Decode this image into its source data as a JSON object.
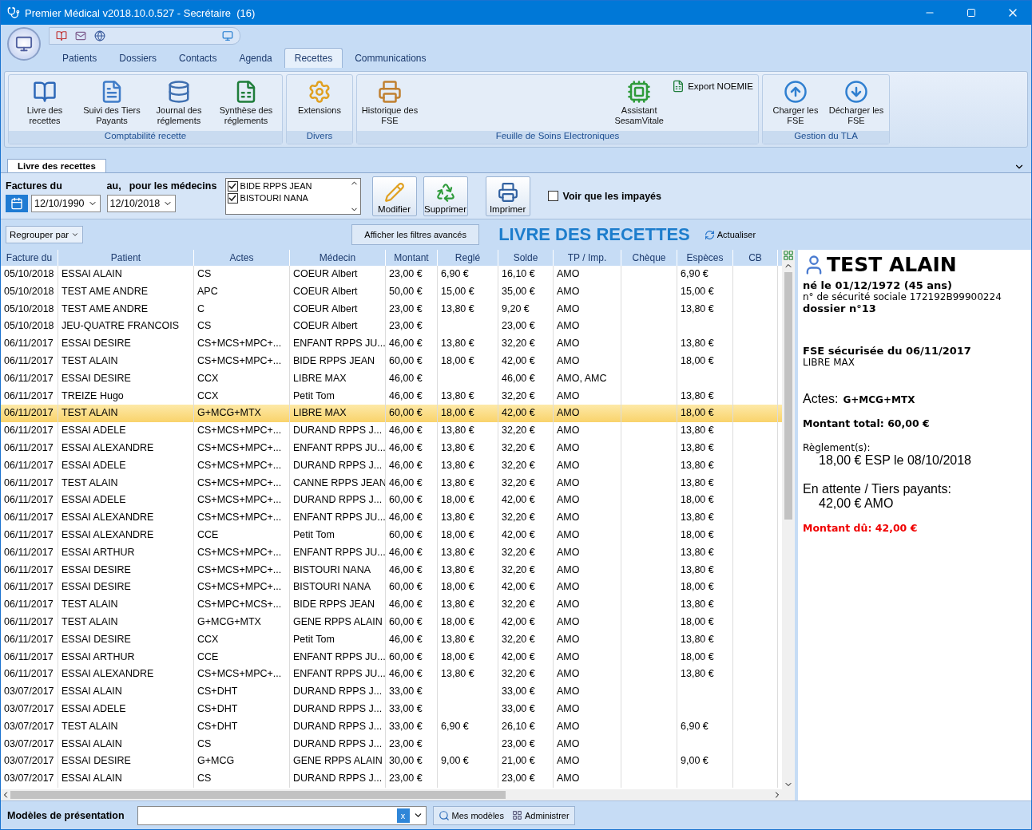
{
  "window": {
    "title": "Premier Médical v2018.10.0.527 - Secrétaire  (16)"
  },
  "menu_tabs": [
    {
      "label": "Patients",
      "selected": false
    },
    {
      "label": "Dossiers",
      "selected": false
    },
    {
      "label": "Contacts",
      "selected": false
    },
    {
      "label": "Agenda",
      "selected": false
    },
    {
      "label": "Recettes",
      "selected": true
    },
    {
      "label": "Communications",
      "selected": false
    }
  ],
  "ribbon_groups": [
    {
      "title": "Comptabilité recette",
      "buttons": [
        {
          "label": "Livre des recettes"
        },
        {
          "label": "Suivi des Tiers Payants"
        },
        {
          "label": "Journal des réglements"
        },
        {
          "label": "Synthèse des réglements"
        }
      ]
    },
    {
      "title": "Divers",
      "buttons": [
        {
          "label": "Extensions"
        }
      ]
    },
    {
      "title": "Feuille de Soins Electroniques",
      "buttons": [
        {
          "label": "Historique des FSE"
        },
        {
          "label": "Assistant SesamVitale"
        },
        {
          "label": "Export NOEMIE"
        }
      ]
    },
    {
      "title": "Gestion du TLA",
      "buttons": [
        {
          "label": "Charger les FSE"
        },
        {
          "label": "Décharger les FSE"
        }
      ]
    }
  ],
  "doc_tab": {
    "label": "Livre des recettes"
  },
  "filters": {
    "from_label": "Factures du",
    "to_label": "au,",
    "doctors_label": "pour les médecins",
    "from_date": "12/10/1990",
    "to_date": "12/10/2018",
    "doctors": [
      {
        "name": "BIDE RPPS JEAN",
        "checked": true
      },
      {
        "name": "BISTOURI NANA",
        "checked": true
      }
    ],
    "actions": [
      {
        "label": "Modifier"
      },
      {
        "label": "Supprimer"
      },
      {
        "label": "Imprimer"
      }
    ],
    "unpaid_only": {
      "label": "Voir que les impayés",
      "checked": false
    }
  },
  "group_by": "Regrouper par",
  "advanced_filters": "Afficher les filtres avancés",
  "heading": "LIVRE DES RECETTES",
  "refresh": "Actualiser",
  "table": {
    "columns": [
      "Facture du",
      "Patient",
      "Actes",
      "Médecin",
      "Montant",
      "Reglé",
      "Solde",
      "TP / Imp.",
      "Chèque",
      "Espèces",
      "CB"
    ],
    "rows": [
      {
        "cells": [
          "05/10/2018",
          "ESSAI ALAIN",
          "CS",
          "COEUR Albert",
          "23,00 €",
          "6,90 €",
          "16,10 €",
          "AMO",
          "",
          "6,90 €",
          ""
        ],
        "selected": false
      },
      {
        "cells": [
          "05/10/2018",
          "TEST AME ANDRE",
          "APC",
          "COEUR Albert",
          "50,00 €",
          "15,00 €",
          "35,00 €",
          "AMO",
          "",
          "15,00 €",
          ""
        ],
        "selected": false
      },
      {
        "cells": [
          "05/10/2018",
          "TEST AME ANDRE",
          "C",
          "COEUR Albert",
          "23,00 €",
          "13,80 €",
          "9,20 €",
          "AMO",
          "",
          "13,80 €",
          ""
        ],
        "selected": false
      },
      {
        "cells": [
          "05/10/2018",
          "JEU-QUATRE FRANCOIS",
          "CS",
          "COEUR Albert",
          "23,00 €",
          "",
          "23,00 €",
          "AMO",
          "",
          "",
          ""
        ],
        "selected": false
      },
      {
        "cells": [
          "06/11/2017",
          "ESSAI DESIRE",
          "CS+MCS+MPC+...",
          "ENFANT  RPPS  JU...",
          "46,00 €",
          "13,80 €",
          "32,20 €",
          "AMO",
          "",
          "13,80 €",
          ""
        ],
        "selected": false
      },
      {
        "cells": [
          "06/11/2017",
          "TEST ALAIN",
          "CS+MCS+MPC+...",
          "BIDE RPPS JEAN",
          "60,00 €",
          "18,00 €",
          "42,00 €",
          "AMO",
          "",
          "18,00 €",
          ""
        ],
        "selected": false
      },
      {
        "cells": [
          "06/11/2017",
          "ESSAI DESIRE",
          "CCX",
          "LIBRE MAX",
          "46,00 €",
          "",
          "46,00 €",
          "AMO, AMC",
          "",
          "",
          ""
        ],
        "selected": false
      },
      {
        "cells": [
          "06/11/2017",
          "TREIZE Hugo",
          "CCX",
          "Petit Tom",
          "46,00 €",
          "13,80 €",
          "32,20 €",
          "AMO",
          "",
          "13,80 €",
          ""
        ],
        "selected": false
      },
      {
        "cells": [
          "06/11/2017",
          "TEST ALAIN",
          "G+MCG+MTX",
          "LIBRE MAX",
          "60,00 €",
          "18,00 €",
          "42,00 €",
          "AMO",
          "",
          "18,00 €",
          ""
        ],
        "selected": true
      },
      {
        "cells": [
          "06/11/2017",
          "ESSAI ADELE",
          "CS+MCS+MPC+...",
          "DURAND  RPPS  J...",
          "46,00 €",
          "13,80 €",
          "32,20 €",
          "AMO",
          "",
          "13,80 €",
          ""
        ],
        "selected": false
      },
      {
        "cells": [
          "06/11/2017",
          "ESSAI ALEXANDRE",
          "CS+MCS+MPC+...",
          "ENFANT  RPPS  JU...",
          "46,00 €",
          "13,80 €",
          "32,20 €",
          "AMO",
          "",
          "13,80 €",
          ""
        ],
        "selected": false
      },
      {
        "cells": [
          "06/11/2017",
          "ESSAI ADELE",
          "CS+MCS+MPC+...",
          "DURAND  RPPS  J...",
          "46,00 €",
          "13,80 €",
          "32,20 €",
          "AMO",
          "",
          "13,80 €",
          ""
        ],
        "selected": false
      },
      {
        "cells": [
          "06/11/2017",
          "TEST ALAIN",
          "CS+MCS+MPC+...",
          "CANNE RPPS JEAN",
          "46,00 €",
          "13,80 €",
          "32,20 €",
          "AMO",
          "",
          "13,80 €",
          ""
        ],
        "selected": false
      },
      {
        "cells": [
          "06/11/2017",
          "ESSAI ADELE",
          "CS+MCS+MPC+...",
          "DURAND  RPPS  J...",
          "60,00 €",
          "18,00 €",
          "42,00 €",
          "AMO",
          "",
          "18,00 €",
          ""
        ],
        "selected": false
      },
      {
        "cells": [
          "06/11/2017",
          "ESSAI ALEXANDRE",
          "CS+MCS+MPC+...",
          "ENFANT  RPPS  JU...",
          "46,00 €",
          "13,80 €",
          "32,20 €",
          "AMO",
          "",
          "13,80 €",
          ""
        ],
        "selected": false
      },
      {
        "cells": [
          "06/11/2017",
          "ESSAI ALEXANDRE",
          "CCE",
          "Petit Tom",
          "60,00 €",
          "18,00 €",
          "42,00 €",
          "AMO",
          "",
          "18,00 €",
          ""
        ],
        "selected": false
      },
      {
        "cells": [
          "06/11/2017",
          "ESSAI ARTHUR",
          "CS+MCS+MPC+...",
          "ENFANT  RPPS  JU...",
          "46,00 €",
          "13,80 €",
          "32,20 €",
          "AMO",
          "",
          "13,80 €",
          ""
        ],
        "selected": false
      },
      {
        "cells": [
          "06/11/2017",
          "ESSAI DESIRE",
          "CS+MCS+MPC+...",
          "BISTOURI NANA",
          "46,00 €",
          "13,80 €",
          "32,20 €",
          "AMO",
          "",
          "13,80 €",
          ""
        ],
        "selected": false
      },
      {
        "cells": [
          "06/11/2017",
          "ESSAI DESIRE",
          "CS+MCS+MPC+...",
          "BISTOURI NANA",
          "60,00 €",
          "18,00 €",
          "42,00 €",
          "AMO",
          "",
          "18,00 €",
          ""
        ],
        "selected": false
      },
      {
        "cells": [
          "06/11/2017",
          "TEST ALAIN",
          "CS+MPC+MCS+...",
          "BIDE RPPS JEAN",
          "46,00 €",
          "13,80 €",
          "32,20 €",
          "AMO",
          "",
          "13,80 €",
          ""
        ],
        "selected": false
      },
      {
        "cells": [
          "06/11/2017",
          "TEST ALAIN",
          "G+MCG+MTX",
          "GENE RPPS ALAIN",
          "60,00 €",
          "18,00 €",
          "42,00 €",
          "AMO",
          "",
          "18,00 €",
          ""
        ],
        "selected": false
      },
      {
        "cells": [
          "06/11/2017",
          "ESSAI DESIRE",
          "CCX",
          "Petit Tom",
          "46,00 €",
          "13,80 €",
          "32,20 €",
          "AMO",
          "",
          "13,80 €",
          ""
        ],
        "selected": false
      },
      {
        "cells": [
          "06/11/2017",
          "ESSAI ARTHUR",
          "CCE",
          "ENFANT  RPPS  JU...",
          "60,00 €",
          "18,00 €",
          "42,00 €",
          "AMO",
          "",
          "18,00 €",
          ""
        ],
        "selected": false
      },
      {
        "cells": [
          "06/11/2017",
          "ESSAI ALEXANDRE",
          "CS+MCS+MPC+...",
          "ENFANT  RPPS  JU...",
          "46,00 €",
          "13,80 €",
          "32,20 €",
          "AMO",
          "",
          "13,80 €",
          ""
        ],
        "selected": false
      },
      {
        "cells": [
          "03/07/2017",
          "ESSAI ALAIN",
          "CS+DHT",
          "DURAND  RPPS  J...",
          "33,00 €",
          "",
          "33,00 €",
          "AMO",
          "",
          "",
          ""
        ],
        "selected": false
      },
      {
        "cells": [
          "03/07/2017",
          "ESSAI ADELE",
          "CS+DHT",
          "DURAND  RPPS  J...",
          "33,00 €",
          "",
          "33,00 €",
          "AMO",
          "",
          "",
          ""
        ],
        "selected": false
      },
      {
        "cells": [
          "03/07/2017",
          "TEST ALAIN",
          "CS+DHT",
          "DURAND  RPPS  J...",
          "33,00 €",
          "6,90 €",
          "26,10 €",
          "AMO",
          "",
          "6,90 €",
          ""
        ],
        "selected": false
      },
      {
        "cells": [
          "03/07/2017",
          "ESSAI ALAIN",
          "CS",
          "DURAND  RPPS  J...",
          "23,00 €",
          "",
          "23,00 €",
          "AMO",
          "",
          "",
          ""
        ],
        "selected": false
      },
      {
        "cells": [
          "03/07/2017",
          "ESSAI DESIRE",
          "G+MCG",
          "GENE RPPS ALAIN",
          "30,00 €",
          "9,00 €",
          "21,00 €",
          "AMO",
          "",
          "9,00 €",
          ""
        ],
        "selected": false
      },
      {
        "cells": [
          "03/07/2017",
          "ESSAI ALAIN",
          "CS",
          "DURAND  RPPS  J...",
          "23,00 €",
          "",
          "23,00 €",
          "AMO",
          "",
          "",
          ""
        ],
        "selected": false
      }
    ]
  },
  "detail": {
    "name": "TEST ALAIN",
    "birth": "né le 01/12/1972 (45 ans)",
    "ssn": "n° de sécurité sociale 172192B99900224",
    "file": "dossier n°13",
    "fse": "FSE sécurisée du 06/11/2017",
    "doctor": "LIBRE MAX",
    "acts_label": "Actes:",
    "acts": "G+MCG+MTX",
    "total": "Montant total: 60,00 €",
    "payments_label": "Règlement(s):",
    "payment": "18,00 € ESP le 08/10/2018",
    "pending_label": "En attente / Tiers payants:",
    "pending": "42,00 € AMO",
    "due": "Montant dû: 42,00 €"
  },
  "bottom_bar": {
    "label": "Modèles de présentation",
    "clear": "x",
    "my_models": "Mes modèles",
    "admin": "Administrer"
  }
}
